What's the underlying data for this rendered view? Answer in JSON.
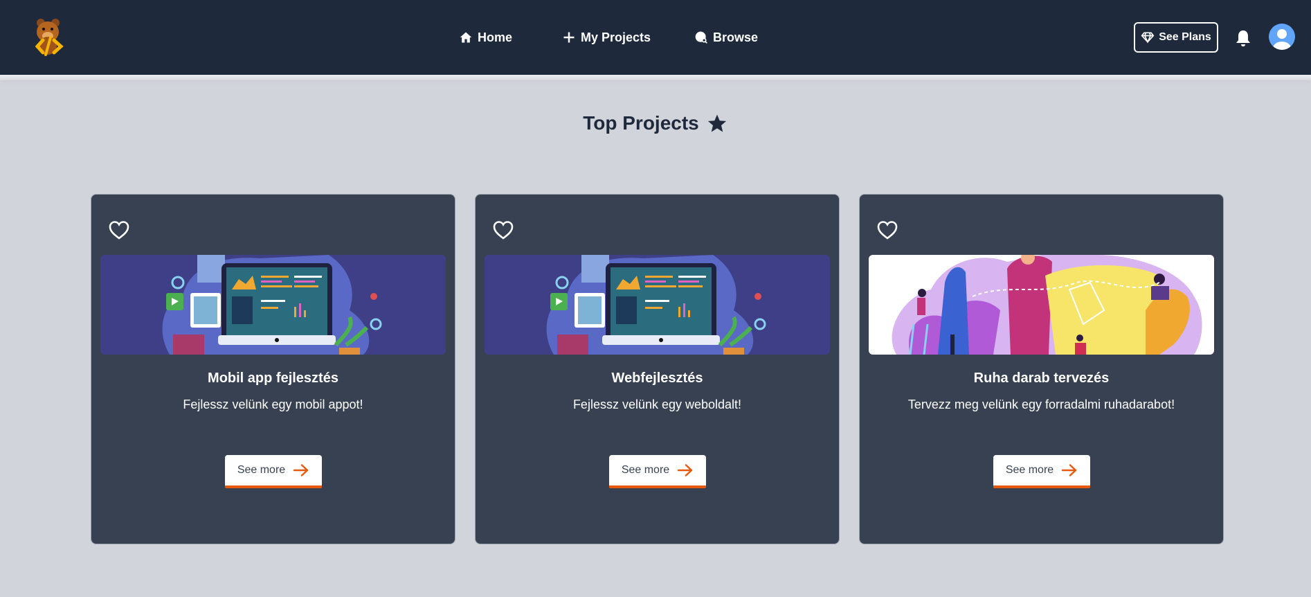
{
  "nav": {
    "home": "Home",
    "projects": "My Projects",
    "browse": "Browse",
    "plans": "See Plans"
  },
  "section": {
    "title": "Top Projects"
  },
  "cards": [
    {
      "title": "Mobil app fejlesztés",
      "desc": "Fejlessz velünk egy mobil appot!",
      "button": "See more"
    },
    {
      "title": "Webfejlesztés",
      "desc": "Fejlessz velünk egy weboldalt!",
      "button": "See more"
    },
    {
      "title": "Ruha darab tervezés",
      "desc": "Tervezz meg velünk egy forradalmi ruhadarabot!",
      "button": "See more"
    }
  ],
  "colors": {
    "navbar": "#1e293b",
    "background": "#d1d5db",
    "card": "#374151",
    "accent": "#ea580c"
  },
  "icons": [
    "logo-icon",
    "home-icon",
    "plus-icon",
    "globe-icon",
    "diamond-icon",
    "bell-icon",
    "user-icon",
    "star-icon",
    "heart-icon",
    "arrow-right-icon"
  ]
}
